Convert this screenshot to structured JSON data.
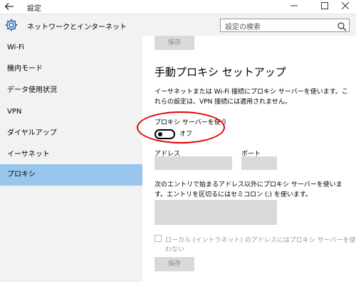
{
  "window": {
    "title": "設定",
    "back_icon": "back-arrow-icon",
    "minimize": "—",
    "maximize": "☐",
    "close": "✕"
  },
  "header": {
    "section_title": "ネットワークとインターネット",
    "icon": "gear-icon",
    "search_placeholder": "設定の検索"
  },
  "sidebar": {
    "items": [
      {
        "label": "Wi-Fi"
      },
      {
        "label": "機内モード"
      },
      {
        "label": "データ使用状況"
      },
      {
        "label": "VPN"
      },
      {
        "label": "ダイヤルアップ"
      },
      {
        "label": "イーサネット"
      },
      {
        "label": "プロキシ",
        "active": true
      }
    ]
  },
  "main": {
    "top_save_label": "保存",
    "heading": "手動プロキシ セットアップ",
    "description": "イーサネットまたは Wi-Fi 接続にプロキシ サーバーを使います。これらの設定は、VPN 接続には適用されません。",
    "use_proxy_label": "プロキシ サーバーを使う",
    "toggle_state": "オフ",
    "address_label": "アドレス",
    "port_label": "ポート",
    "exceptions_text": "次のエントリで始まるアドレス以外にプロキシ サーバーを使います。エントリを区切るにはセミコロン (;) を使います。",
    "local_bypass_label": "ローカル (イントラネット) のアドレスにはプロキシ サーバーを使わない",
    "bottom_save_label": "保存"
  },
  "colors": {
    "active_nav": "#99c6ec",
    "annotation": "#e60000",
    "disabled_fill": "#d9d9d9"
  }
}
